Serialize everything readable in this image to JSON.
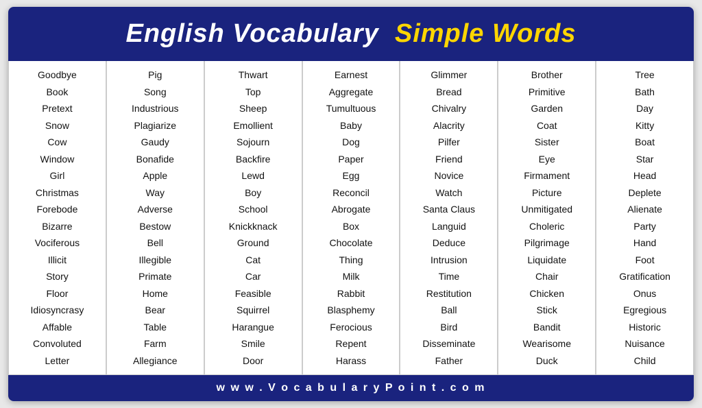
{
  "header": {
    "title_white": "English Vocabulary",
    "title_yellow": "Simple Words"
  },
  "columns": [
    {
      "words": [
        "Goodbye",
        "Book",
        "Pretext",
        "Snow",
        "Cow",
        "Window",
        "Girl",
        "Christmas",
        "Forebode",
        "Bizarre",
        "Vociferous",
        "Illicit",
        "Story",
        "Floor",
        "Idiosyncrasy",
        "Affable",
        "Convoluted",
        "Letter"
      ]
    },
    {
      "words": [
        "Pig",
        "Song",
        "Industrious",
        "Plagiarize",
        "Gaudy",
        "Bonafide",
        "Apple",
        "Way",
        "Adverse",
        "Bestow",
        "Bell",
        "Illegible",
        "Primate",
        "Home",
        "Bear",
        "Table",
        "Farm",
        "Allegiance"
      ]
    },
    {
      "words": [
        "Thwart",
        "Top",
        "Sheep",
        "Emollient",
        "Sojourn",
        "Backfire",
        "Lewd",
        "Boy",
        "School",
        "Knickknack",
        "Ground",
        "Cat",
        "Car",
        "Feasible",
        "Squirrel",
        "Harangue",
        "Smile",
        "Door"
      ]
    },
    {
      "words": [
        "Earnest",
        "Aggregate",
        "Tumultuous",
        "Baby",
        "Dog",
        "Paper",
        "Egg",
        "Reconcil",
        "Abrogate",
        "Box",
        "Chocolate",
        "Thing",
        "Milk",
        "Rabbit",
        "Blasphemy",
        "Ferocious",
        "Repent",
        "Harass"
      ]
    },
    {
      "words": [
        "Glimmer",
        "Bread",
        "Chivalry",
        "Alacrity",
        "Pilfer",
        "Friend",
        "Novice",
        "Watch",
        "Santa Claus",
        "Languid",
        "Deduce",
        "Intrusion",
        "Time",
        "Restitution",
        "Ball",
        "Bird",
        "Disseminate",
        "Father"
      ]
    },
    {
      "words": [
        "Brother",
        "Primitive",
        "Garden",
        "Coat",
        "Sister",
        "Eye",
        "Firmament",
        "Picture",
        "Unmitigated",
        "Choleric",
        "Pilgrimage",
        "Liquidate",
        "Chair",
        "Chicken",
        "Stick",
        "Bandit",
        "Wearisome",
        "Duck"
      ]
    },
    {
      "words": [
        "Tree",
        "Bath",
        "Day",
        "Kitty",
        "Boat",
        "Star",
        "Head",
        "Deplete",
        "Alienate",
        "Party",
        "Hand",
        "Foot",
        "Gratification",
        "Onus",
        "Egregious",
        "Historic",
        "Nuisance",
        "Child"
      ]
    }
  ],
  "footer": {
    "url": "w w w . V o c a b u l a r y P o i n t . c o m"
  }
}
